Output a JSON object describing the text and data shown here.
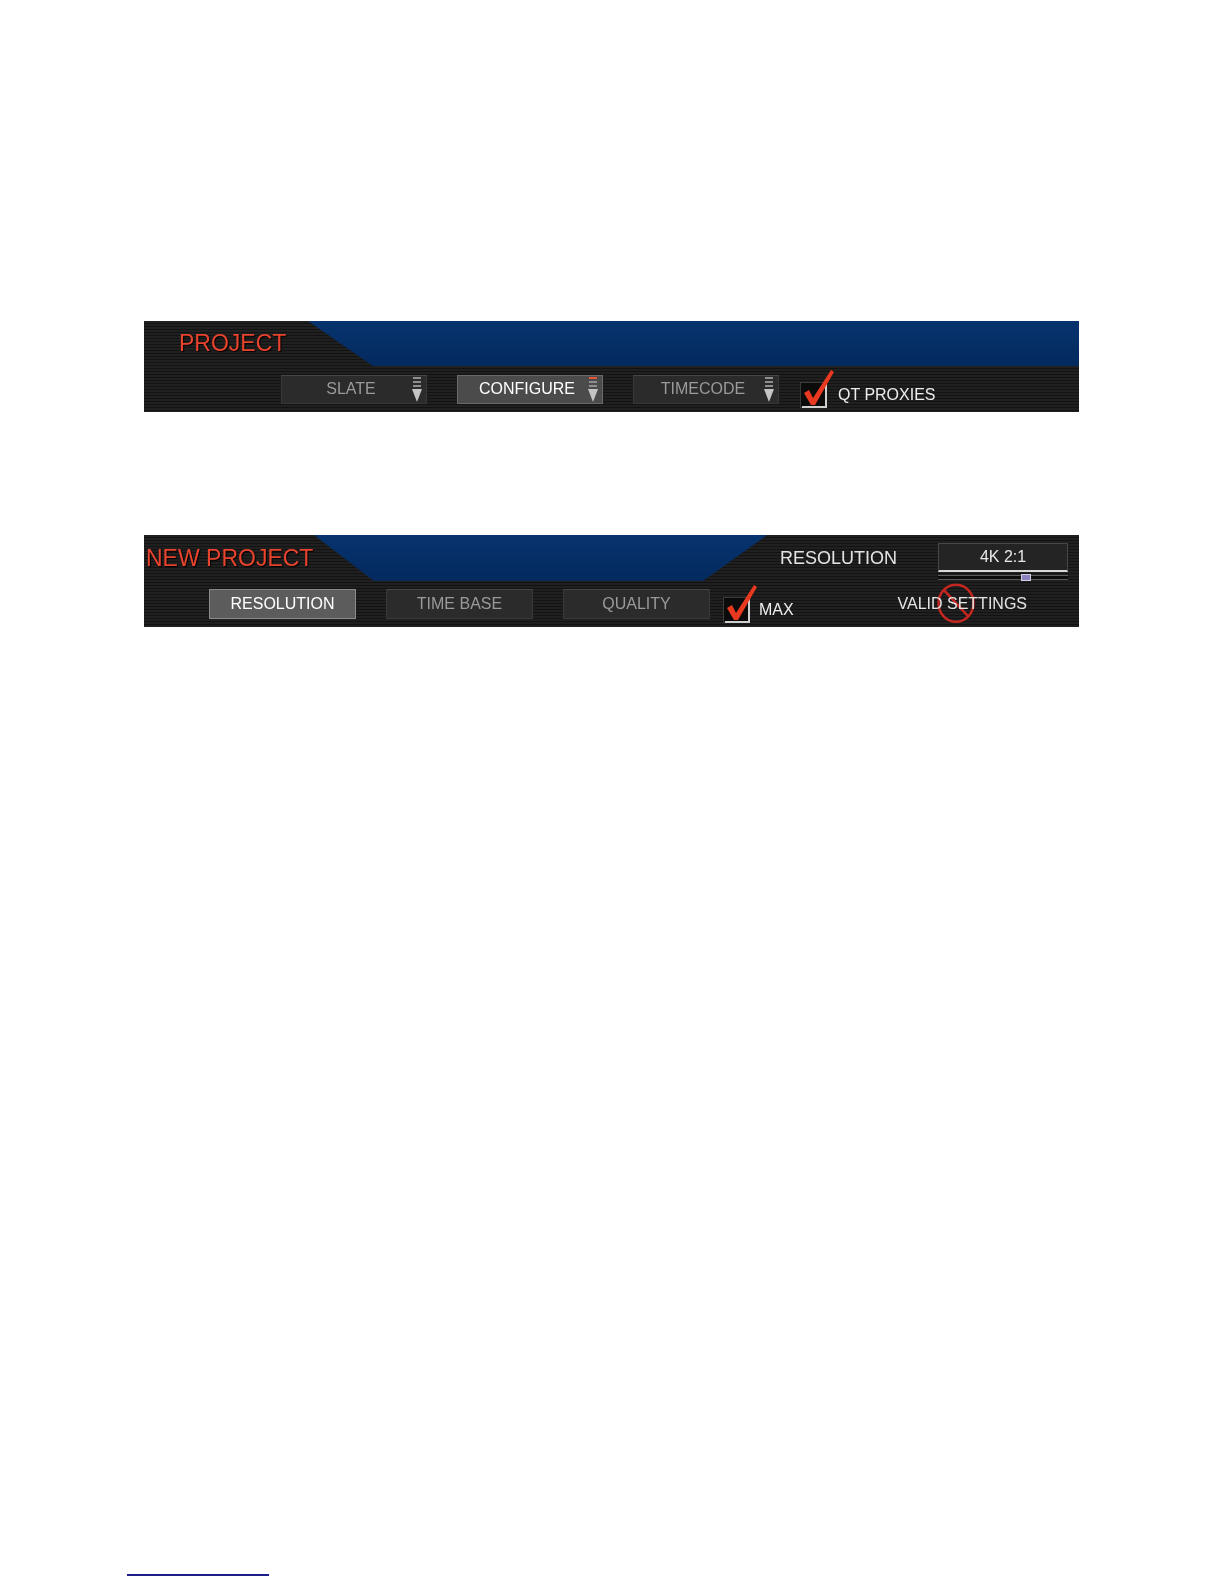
{
  "project_panel": {
    "title": "PROJECT",
    "buttons": [
      {
        "label": "SLATE",
        "selected": false
      },
      {
        "label": "CONFIGURE",
        "selected": true
      },
      {
        "label": "TIMECODE",
        "selected": false
      }
    ],
    "checkbox": {
      "label": "QT PROXIES",
      "checked": true
    }
  },
  "new_project_panel": {
    "title": "NEW PROJECT",
    "setting": {
      "label": "RESOLUTION",
      "value": "4K 2:1",
      "level": 0.68
    },
    "tabs": [
      {
        "label": "RESOLUTION",
        "selected": true
      },
      {
        "label": "TIME BASE",
        "selected": false
      },
      {
        "label": "QUALITY",
        "selected": false
      }
    ],
    "checkbox": {
      "label": "MAX",
      "checked": true
    },
    "status": {
      "label": "VALID SETTINGS",
      "valid": false
    }
  }
}
